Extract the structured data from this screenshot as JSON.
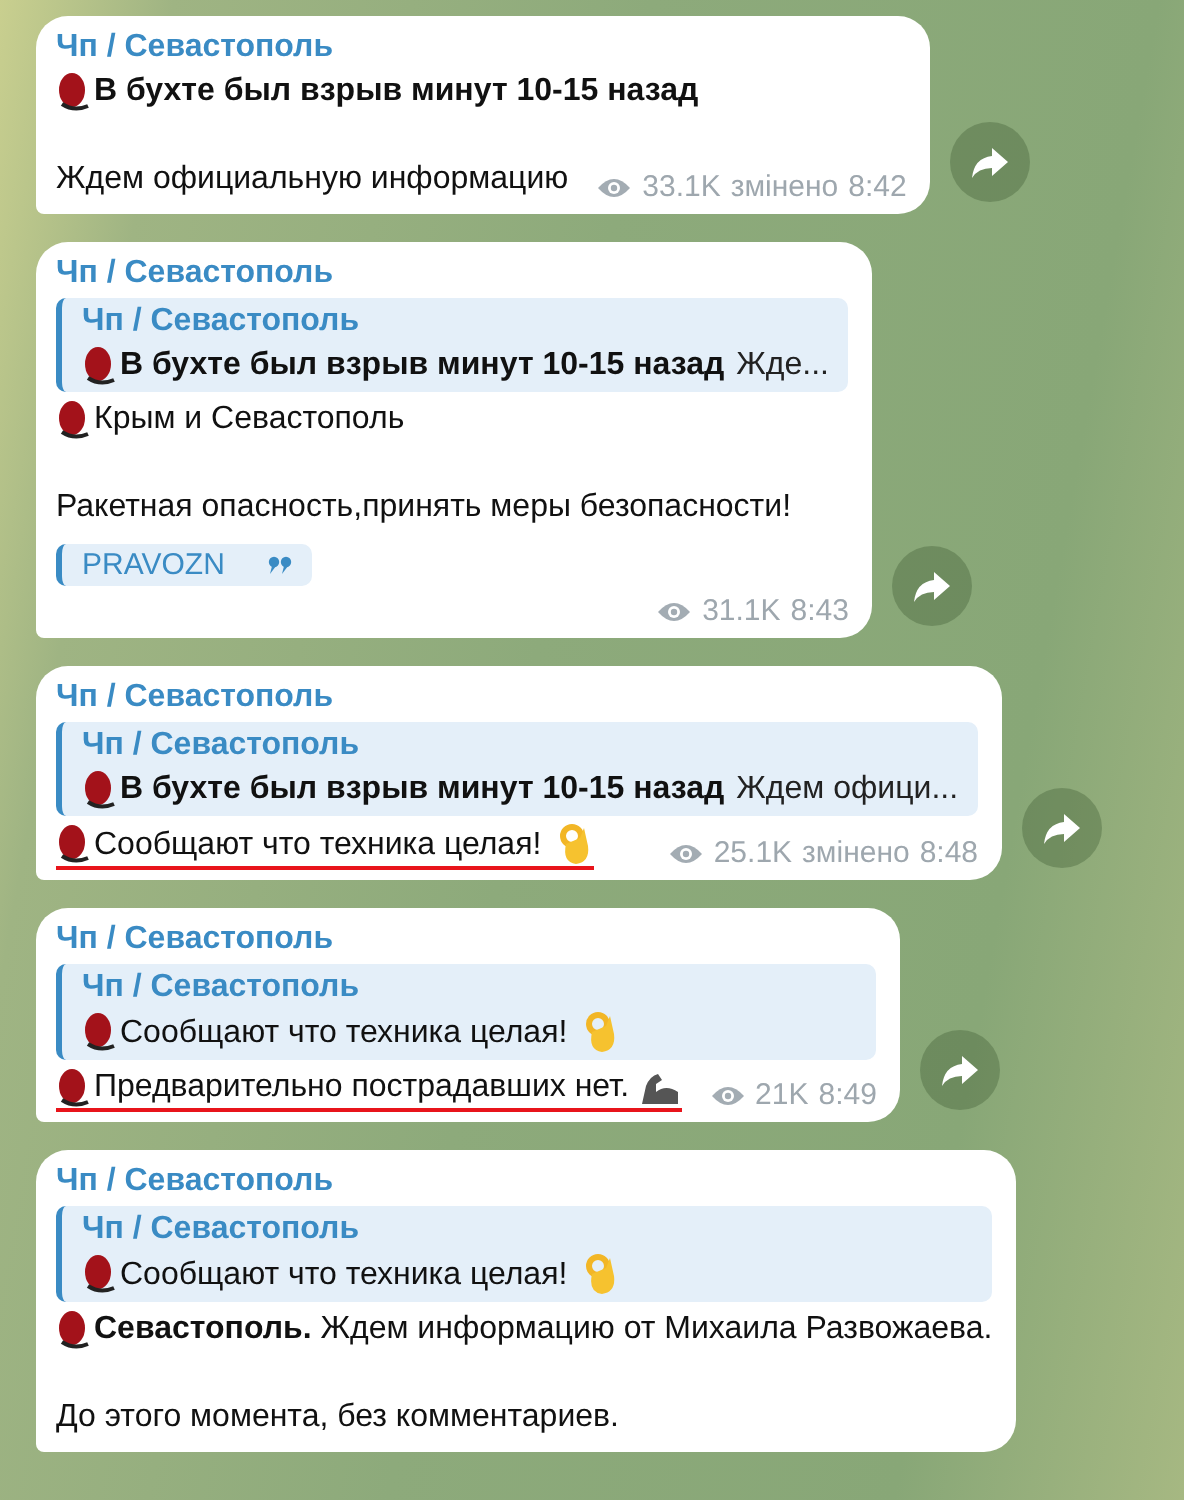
{
  "messages": [
    {
      "sender": "Чп / Севастополь",
      "paragraphs": [
        {
          "blob_icon": true,
          "ok_hand": false,
          "flexed_arm": false,
          "text": "В бухте был взрыв минут 10-15 назад",
          "bold": true,
          "underlined": false,
          "blank_before": false
        },
        {
          "blob_icon": false,
          "ok_hand": false,
          "flexed_arm": false,
          "text": "Ждем официальную информацию",
          "bold": false,
          "underlined": false,
          "blank_before": true
        }
      ],
      "meta_inline": true,
      "views": "33.1K",
      "edited": "змінено",
      "time": "8:42"
    },
    {
      "sender": "Чп / Севастополь",
      "reply": {
        "sender": "Чп / Севастополь",
        "blob_icon": true,
        "ok_hand": false,
        "text": "В бухте был взрыв минут 10-15 назад",
        "bold": true,
        "more": "Жде..."
      },
      "paragraphs": [
        {
          "blob_icon": true,
          "ok_hand": false,
          "flexed_arm": false,
          "text": "Крым и Севастополь",
          "bold": false,
          "underlined": false,
          "blank_before": false
        },
        {
          "blob_icon": false,
          "ok_hand": false,
          "flexed_arm": false,
          "text": "Ракетная опасность,принять меры безопасности!",
          "bold": false,
          "underlined": false,
          "blank_before": true
        }
      ],
      "signature": "PRAVOZN",
      "meta_inline": false,
      "views": "31.1K",
      "time": "8:43"
    },
    {
      "sender": "Чп / Севастополь",
      "reply": {
        "sender": "Чп / Севастополь",
        "blob_icon": true,
        "ok_hand": false,
        "text": "В бухте был взрыв минут 10-15 назад",
        "bold": true,
        "more": "Ждем офици..."
      },
      "paragraphs": [
        {
          "blob_icon": true,
          "ok_hand": true,
          "flexed_arm": false,
          "text": "Сообщают что техника целая!",
          "bold": false,
          "underlined": true,
          "blank_before": false
        }
      ],
      "meta_inline": true,
      "views": "25.1K",
      "edited": "змінено",
      "time": "8:48"
    },
    {
      "sender": "Чп / Севастополь",
      "reply": {
        "sender": "Чп / Севастополь",
        "blob_icon": true,
        "ok_hand": true,
        "text": "Сообщают что техника целая!",
        "bold": false
      },
      "paragraphs": [
        {
          "blob_icon": true,
          "ok_hand": false,
          "flexed_arm": true,
          "text": "Предварительно пострадавших нет.",
          "bold": false,
          "underlined": true,
          "blank_before": false
        }
      ],
      "meta_inline": true,
      "views": "21K",
      "time": "8:49"
    },
    {
      "sender": "Чп / Севастополь",
      "reply": {
        "sender": "Чп / Севастополь",
        "blob_icon": true,
        "ok_hand": true,
        "text": "Сообщают что техника целая!",
        "bold": false
      },
      "paragraphs": [
        {
          "blob_icon": true,
          "ok_hand": false,
          "flexed_arm": false,
          "text": "**Севастополь.** Ждем информацию от Михаила Развожаева.",
          "bold": false,
          "underlined": false,
          "blank_before": false
        },
        {
          "blob_icon": false,
          "ok_hand": false,
          "flexed_arm": false,
          "text": "До этого момента, без комментариев.",
          "bold": false,
          "underlined": false,
          "blank_before": true
        }
      ]
    }
  ]
}
